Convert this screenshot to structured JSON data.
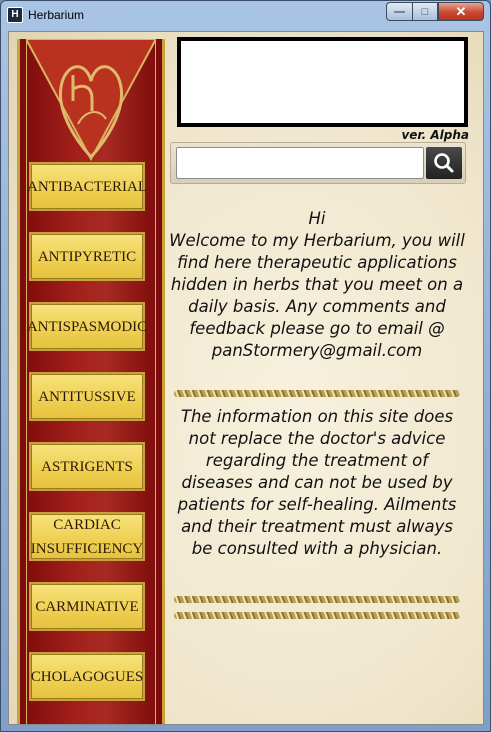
{
  "window": {
    "title": "Herbarium",
    "icon": "app-herbarium-icon",
    "controls": {
      "minimize": "—",
      "maximize": "□",
      "close": "✕"
    }
  },
  "sidebar": {
    "items": [
      {
        "label": "ANTIBACTERIAL"
      },
      {
        "label": "ANTIPYRETIC"
      },
      {
        "label": "ANTISPASMODIC"
      },
      {
        "label": "ANTITUSSIVE"
      },
      {
        "label": "ASTRIGENTS"
      },
      {
        "label": "CARDIAC\nINSUFFICIENCY"
      },
      {
        "label": "CARMINATIVE"
      },
      {
        "label": "CHOLAGOGUES"
      }
    ]
  },
  "header": {
    "version": "ver. Alpha"
  },
  "search": {
    "value": "",
    "placeholder": "",
    "button_icon": "search-icon"
  },
  "main": {
    "greeting": "Hi",
    "welcome": "Welcome to my Herbarium, you will find here therapeutic applications hidden in herbs that you meet on a daily basis. Any comments and feedback please go to email @ panStormery@gmail.com",
    "disclaimer": "The information on this site does not replace the doctor's advice regarding the treatment of diseases and can not be used by patients for self-healing. Ailments and their treatment must always be consulted with a physician."
  },
  "colors": {
    "banner_red": "#a3201b",
    "gold": "#efcf50",
    "parchment": "#f2ead2"
  }
}
